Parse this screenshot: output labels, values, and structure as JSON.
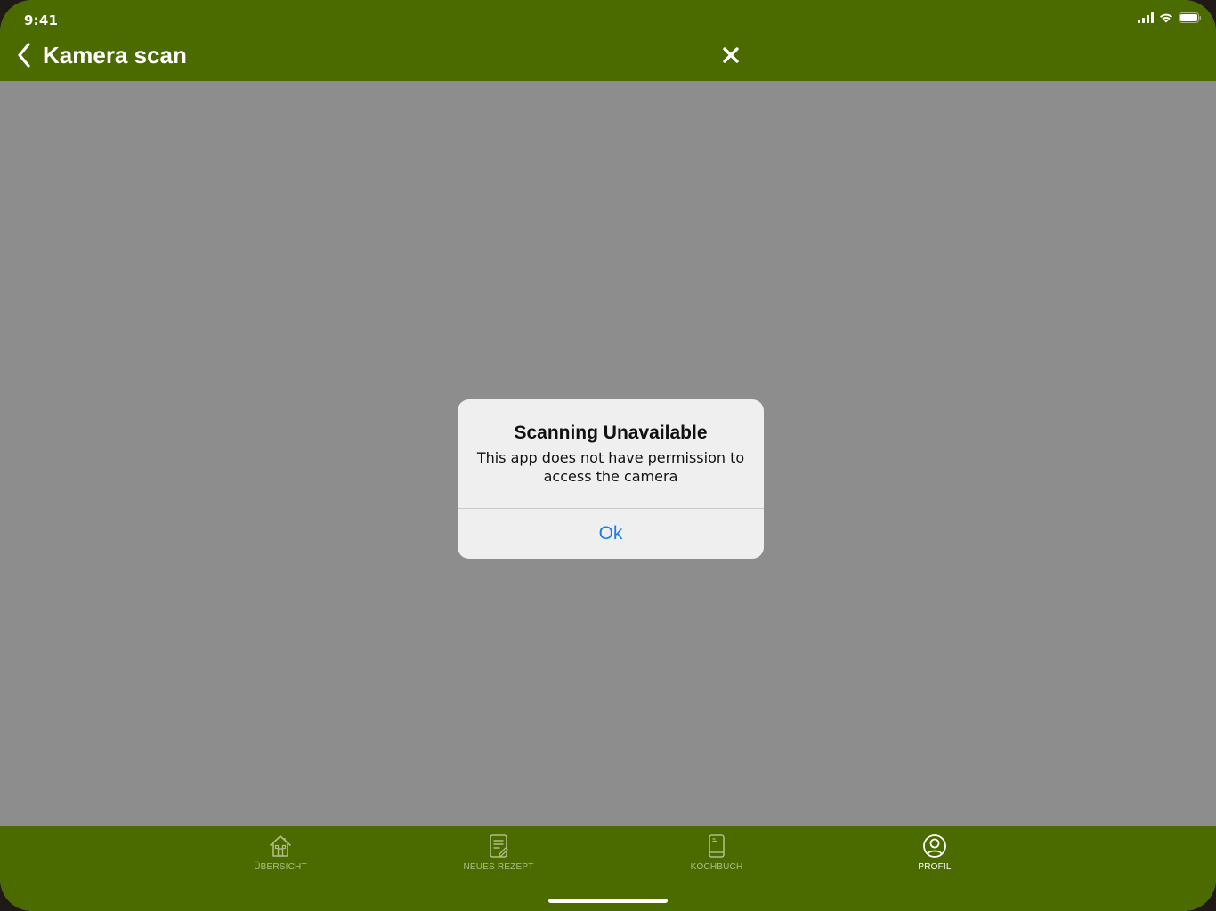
{
  "status_bar": {
    "time": "9:41"
  },
  "header": {
    "title": "Kamera scan",
    "back_icon": "chevron-left-icon",
    "close_icon": "close-icon",
    "background_color": "#4b6b00"
  },
  "alert": {
    "title": "Scanning Unavailable",
    "message": "This app does not have permission to access the camera",
    "ok_label": "Ok",
    "button_color": "#1a7cf0"
  },
  "tabbar": {
    "items": [
      {
        "label": "ÜBERSICHT",
        "icon": "home-icon",
        "active": false
      },
      {
        "label": "NEUES REZEPT",
        "icon": "new-recipe-icon",
        "active": false
      },
      {
        "label": "KOCHBUCH",
        "icon": "cookbook-icon",
        "active": false
      },
      {
        "label": "PROFIL",
        "icon": "profile-icon",
        "active": true
      }
    ],
    "active_color": "#ffffff",
    "inactive_color": "#aebf86"
  }
}
